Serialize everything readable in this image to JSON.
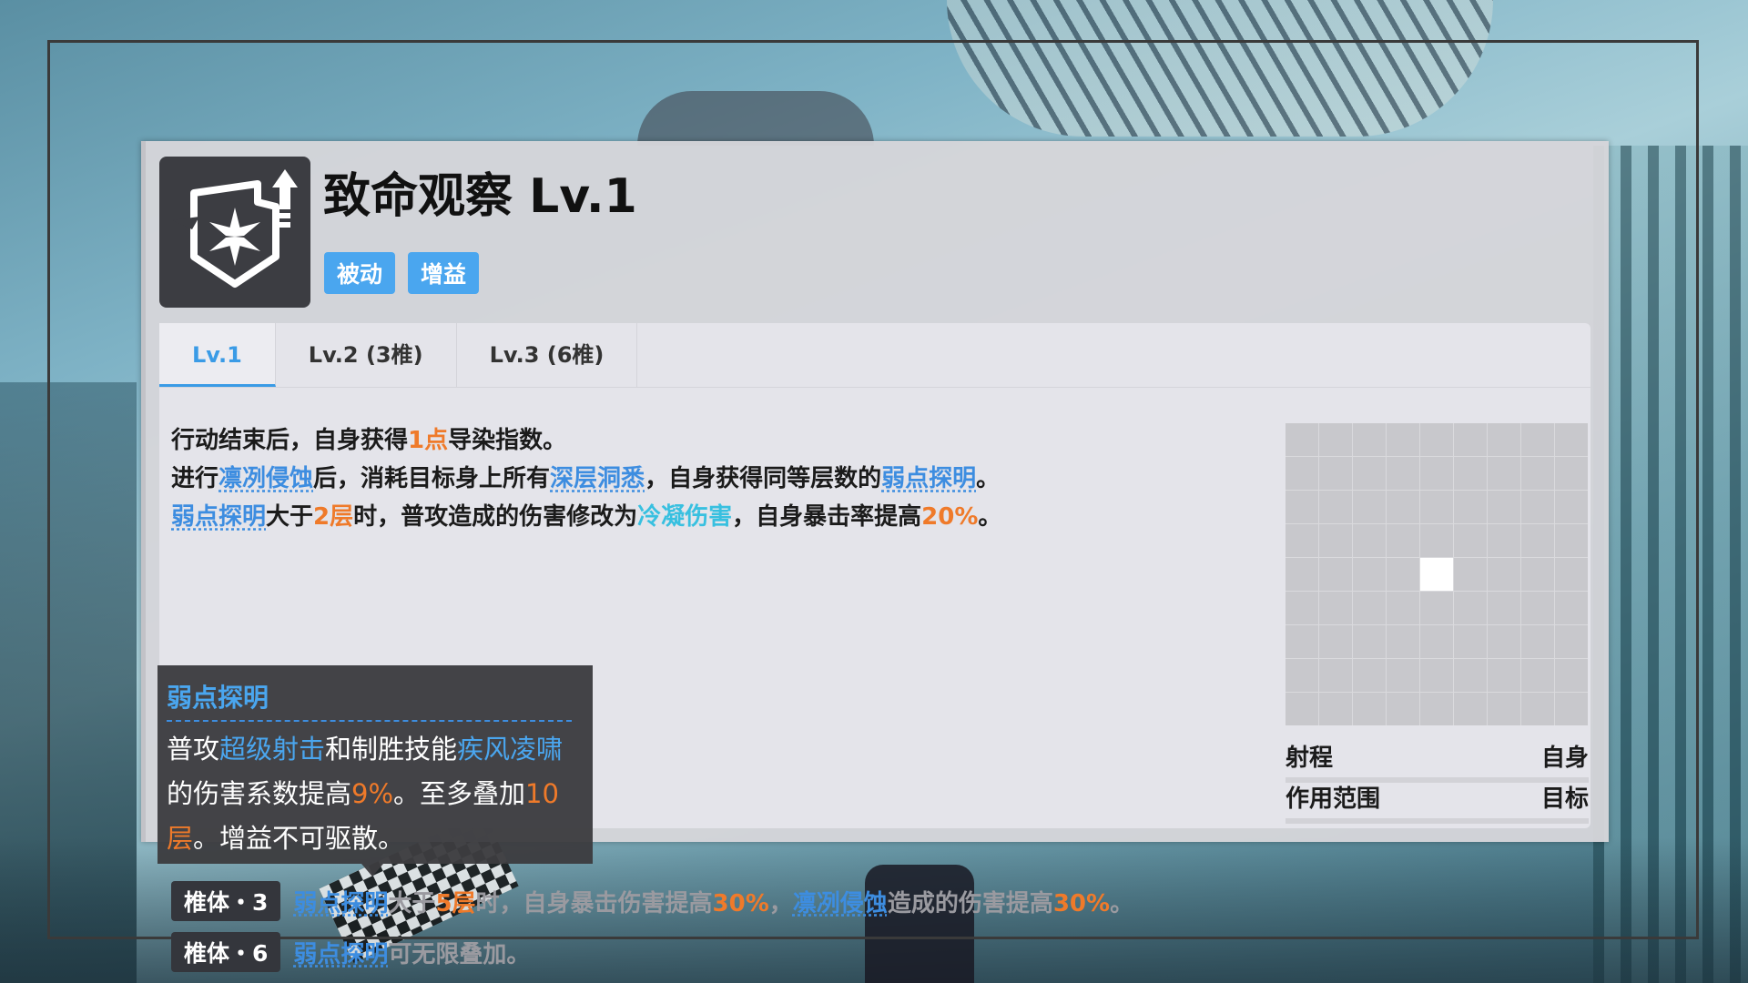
{
  "skill": {
    "title": "致命观察 Lv.1",
    "tags": [
      "被动",
      "增益"
    ],
    "icon": "snowflake-shield-up-icon"
  },
  "tabs": [
    {
      "label": "Lv.1",
      "active": true
    },
    {
      "label": "Lv.2 (3椎)",
      "active": false
    },
    {
      "label": "Lv.3 (6椎)",
      "active": false
    }
  ],
  "description": {
    "line1": {
      "a": "行动结束后，自身获得",
      "b": "1点",
      "c": "导染指数。"
    },
    "line2": {
      "a": "进行",
      "b": "凛冽侵蚀",
      "c": "后，消耗目标身上所有",
      "d": "深层洞悉",
      "e": "，自身获得同等层数的",
      "f": "弱点探明",
      "g": "。"
    },
    "line3": {
      "a": "弱点探明",
      "b": "大于",
      "c": "2层",
      "d": "时，普攻造成的伤害修改为",
      "e": "冷凝伤害",
      "f": "，自身暴击率提高",
      "g": "20%",
      "h": "。"
    }
  },
  "tooltip": {
    "title": "弱点探明",
    "t1": "普攻",
    "t2": "超级射击",
    "t3": "和制胜技能",
    "t4": "疾风凌啸",
    "t5": "的伤害系数提高",
    "t6": "9%",
    "t7": "。至多叠加",
    "t8": "10层",
    "t9": "。增益不可驱散。"
  },
  "upgrades": [
    {
      "badge": "椎体・3",
      "a": "弱点探明",
      "b": "大于",
      "c": "5层",
      "d": "时，自身暴击伤害提高",
      "e": "30%",
      "f": "，",
      "g": "凛冽侵蚀",
      "h": "造成的伤害提高",
      "i": "30%",
      "j": "。"
    },
    {
      "badge": "椎体・6",
      "a": "弱点探明",
      "b": "可无限叠加。"
    }
  ],
  "range_grid": {
    "rows": 9,
    "cols": 9,
    "self_cell": [
      4,
      4
    ]
  },
  "stats": [
    {
      "label": "射程",
      "value": "自身"
    },
    {
      "label": "作用范围",
      "value": "目标"
    }
  ],
  "colors": {
    "accent": "#4aa6ef",
    "number": "#ef7a2a",
    "cold": "#38c0e0"
  }
}
